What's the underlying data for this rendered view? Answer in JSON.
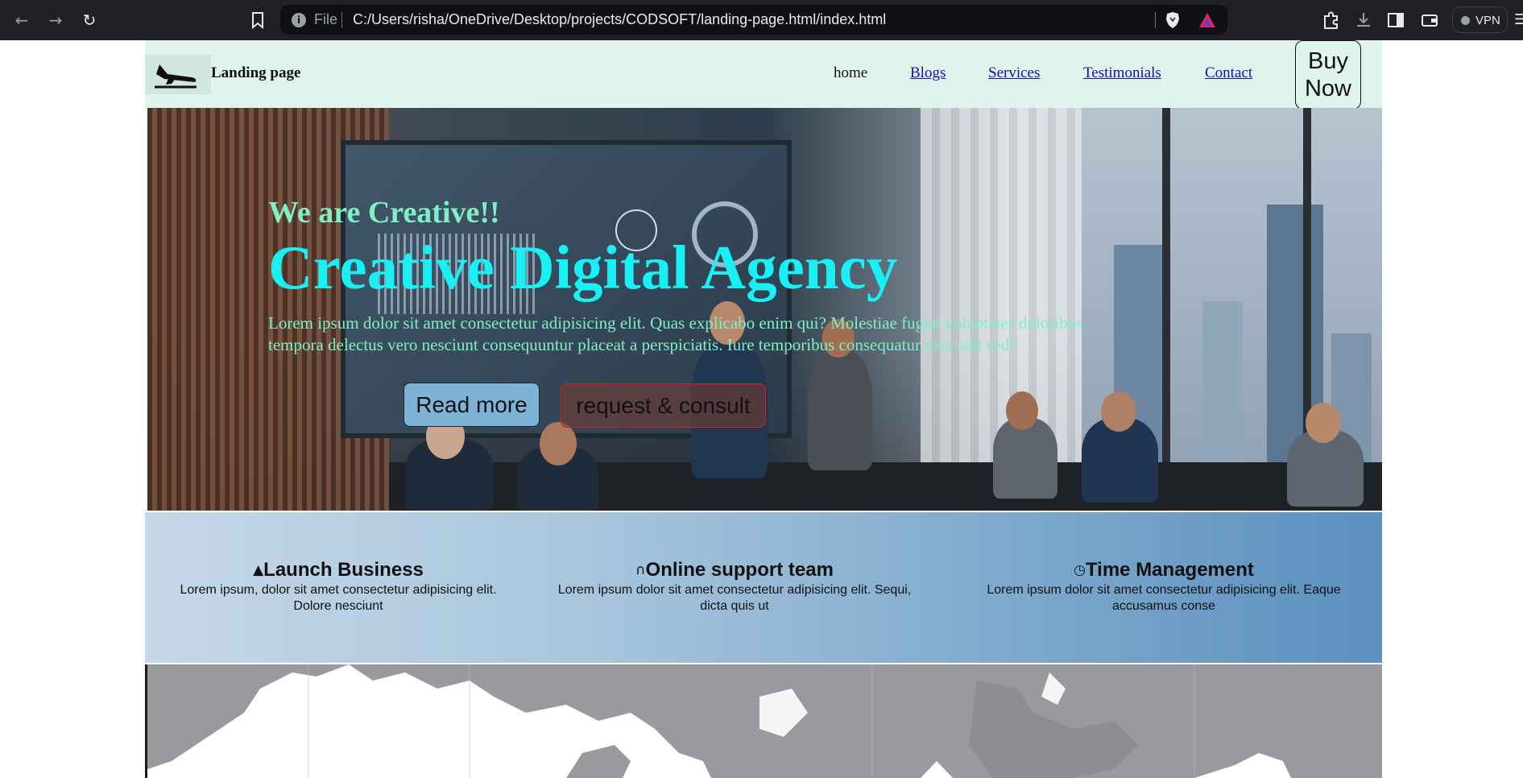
{
  "browser": {
    "address_scheme": "File",
    "url": "C:/Users/risha/OneDrive/Desktop/projects/CODSOFT/landing-page.html/index.html",
    "vpn_label": "VPN"
  },
  "navbar": {
    "brand": "Landing page",
    "links": [
      {
        "label": "home"
      },
      {
        "label": "Blogs"
      },
      {
        "label": "Services"
      },
      {
        "label": "Testimonials"
      },
      {
        "label": "Contact"
      }
    ],
    "buy_line1": "Buy",
    "buy_line2": "Now"
  },
  "hero": {
    "subtitle": "We are Creative!!",
    "title": "Creative Digital Agency",
    "text": "Lorem ipsum dolor sit amet consectetur adipisicing elit. Quas explicabo enim qui? Molestiae fugiat voluptates doloribus tempora delectus vero nesciunt consequuntur placeat a perspiciatis. Iure temporibus consequatur ipsa odit sed?",
    "read_more": "Read more",
    "consult": "request & consult"
  },
  "features": [
    {
      "icon": "rocket-icon",
      "title": "Launch Business",
      "text": "Lorem ipsum, dolor sit amet consectetur adipisicing elit. Dolore nesciunt"
    },
    {
      "icon": "headphones-icon",
      "title": "Online support team",
      "text": "Lorem ipsum dolor sit amet consectetur adipisicing elit. Sequi, dicta quis ut"
    },
    {
      "icon": "clock-icon",
      "title": "Time Management",
      "text": "Lorem ipsum dolor sit amet consectetur adipisicing elit. Eaque accusamus conse"
    }
  ],
  "colors": {
    "navbar_bg": "#e0f4ee",
    "hero_subtitle": "#7ff0c4",
    "hero_title": "#19f0f5",
    "link": "#1a0dab",
    "read_more_bg": "#7eb3d8",
    "consult_border": "#cc2222"
  }
}
